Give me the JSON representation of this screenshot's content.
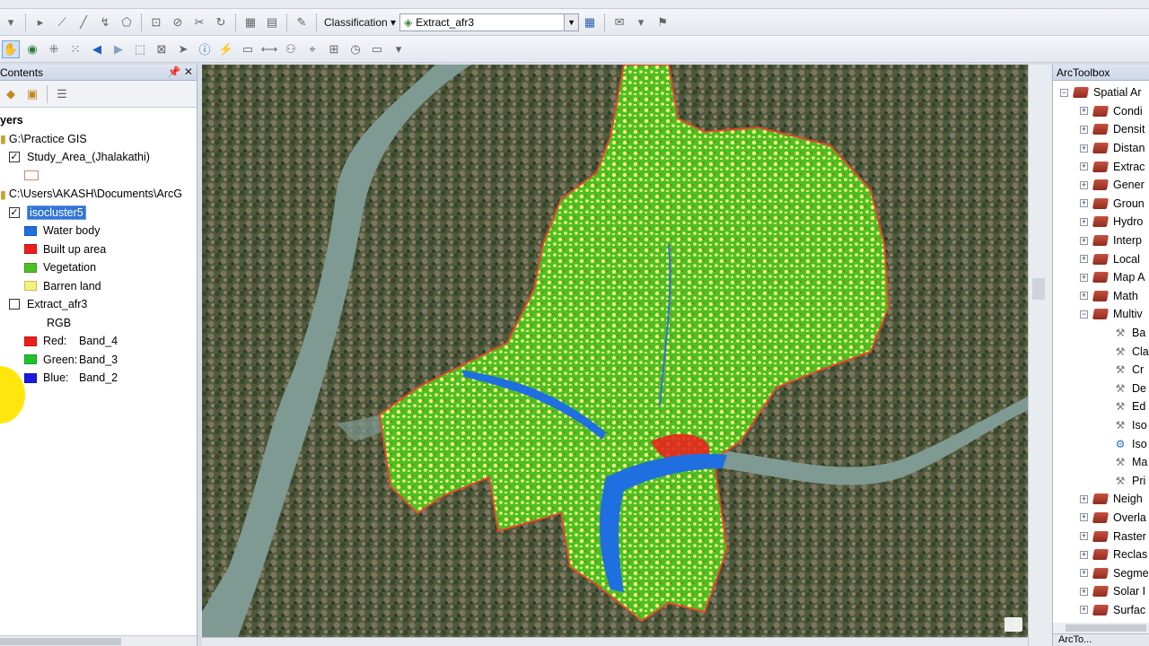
{
  "toolbar": {
    "classification_label": "Classification",
    "layer_combo_value": "Extract_afr3"
  },
  "toc": {
    "title": "Contents",
    "pin": "📌 ✕",
    "layers_header": "yers",
    "group1_path": "G:\\Practice GIS",
    "study_area_label": "Study_Area_(Jhalakathi)",
    "group2_path": "C:\\Users\\AKASH\\Documents\\ArcG",
    "isocluster_label": "isocluster5",
    "classes": [
      {
        "label": "Water body",
        "color": "#1f6fe0"
      },
      {
        "label": "Built up area",
        "color": "#ee1c1c"
      },
      {
        "label": "Vegetation",
        "color": "#4cbf24"
      },
      {
        "label": "Barren land",
        "color": "#f3f27a"
      }
    ],
    "extract_label": "Extract_afr3",
    "rgb_label": "RGB",
    "bands": [
      {
        "channel": "Red:",
        "band": "Band_4",
        "color": "#ee1c1c"
      },
      {
        "channel": "Green:",
        "band": "Band_3",
        "color": "#22c02a"
      },
      {
        "channel": "Blue:",
        "band": "Band_2",
        "color": "#1a1ae0"
      }
    ]
  },
  "arctoolbox": {
    "title": "ArcToolbox",
    "root_label": "Spatial Ar",
    "tools": [
      "Condi",
      "Densit",
      "Distan",
      "Extrac",
      "Gener",
      "Groun",
      "Hydro",
      "Interp",
      "Local",
      "Map A",
      "Math",
      "Multiv"
    ],
    "multiv_children": [
      "Ba",
      "Cla",
      "Cr",
      "De",
      "Ed",
      "Iso",
      "Iso",
      "Ma",
      "Pri"
    ],
    "tools_after": [
      "Neigh",
      "Overla",
      "Raster",
      "Reclas",
      "Segme",
      "Solar I",
      "Surfac"
    ],
    "tab_label": "ArcTo..."
  },
  "colors": {
    "water": "#1f6fe0",
    "built": "#ee1c1c",
    "vegetation": "#4cbf24",
    "barren": "#f3f27a",
    "river": "#7f9a93"
  }
}
